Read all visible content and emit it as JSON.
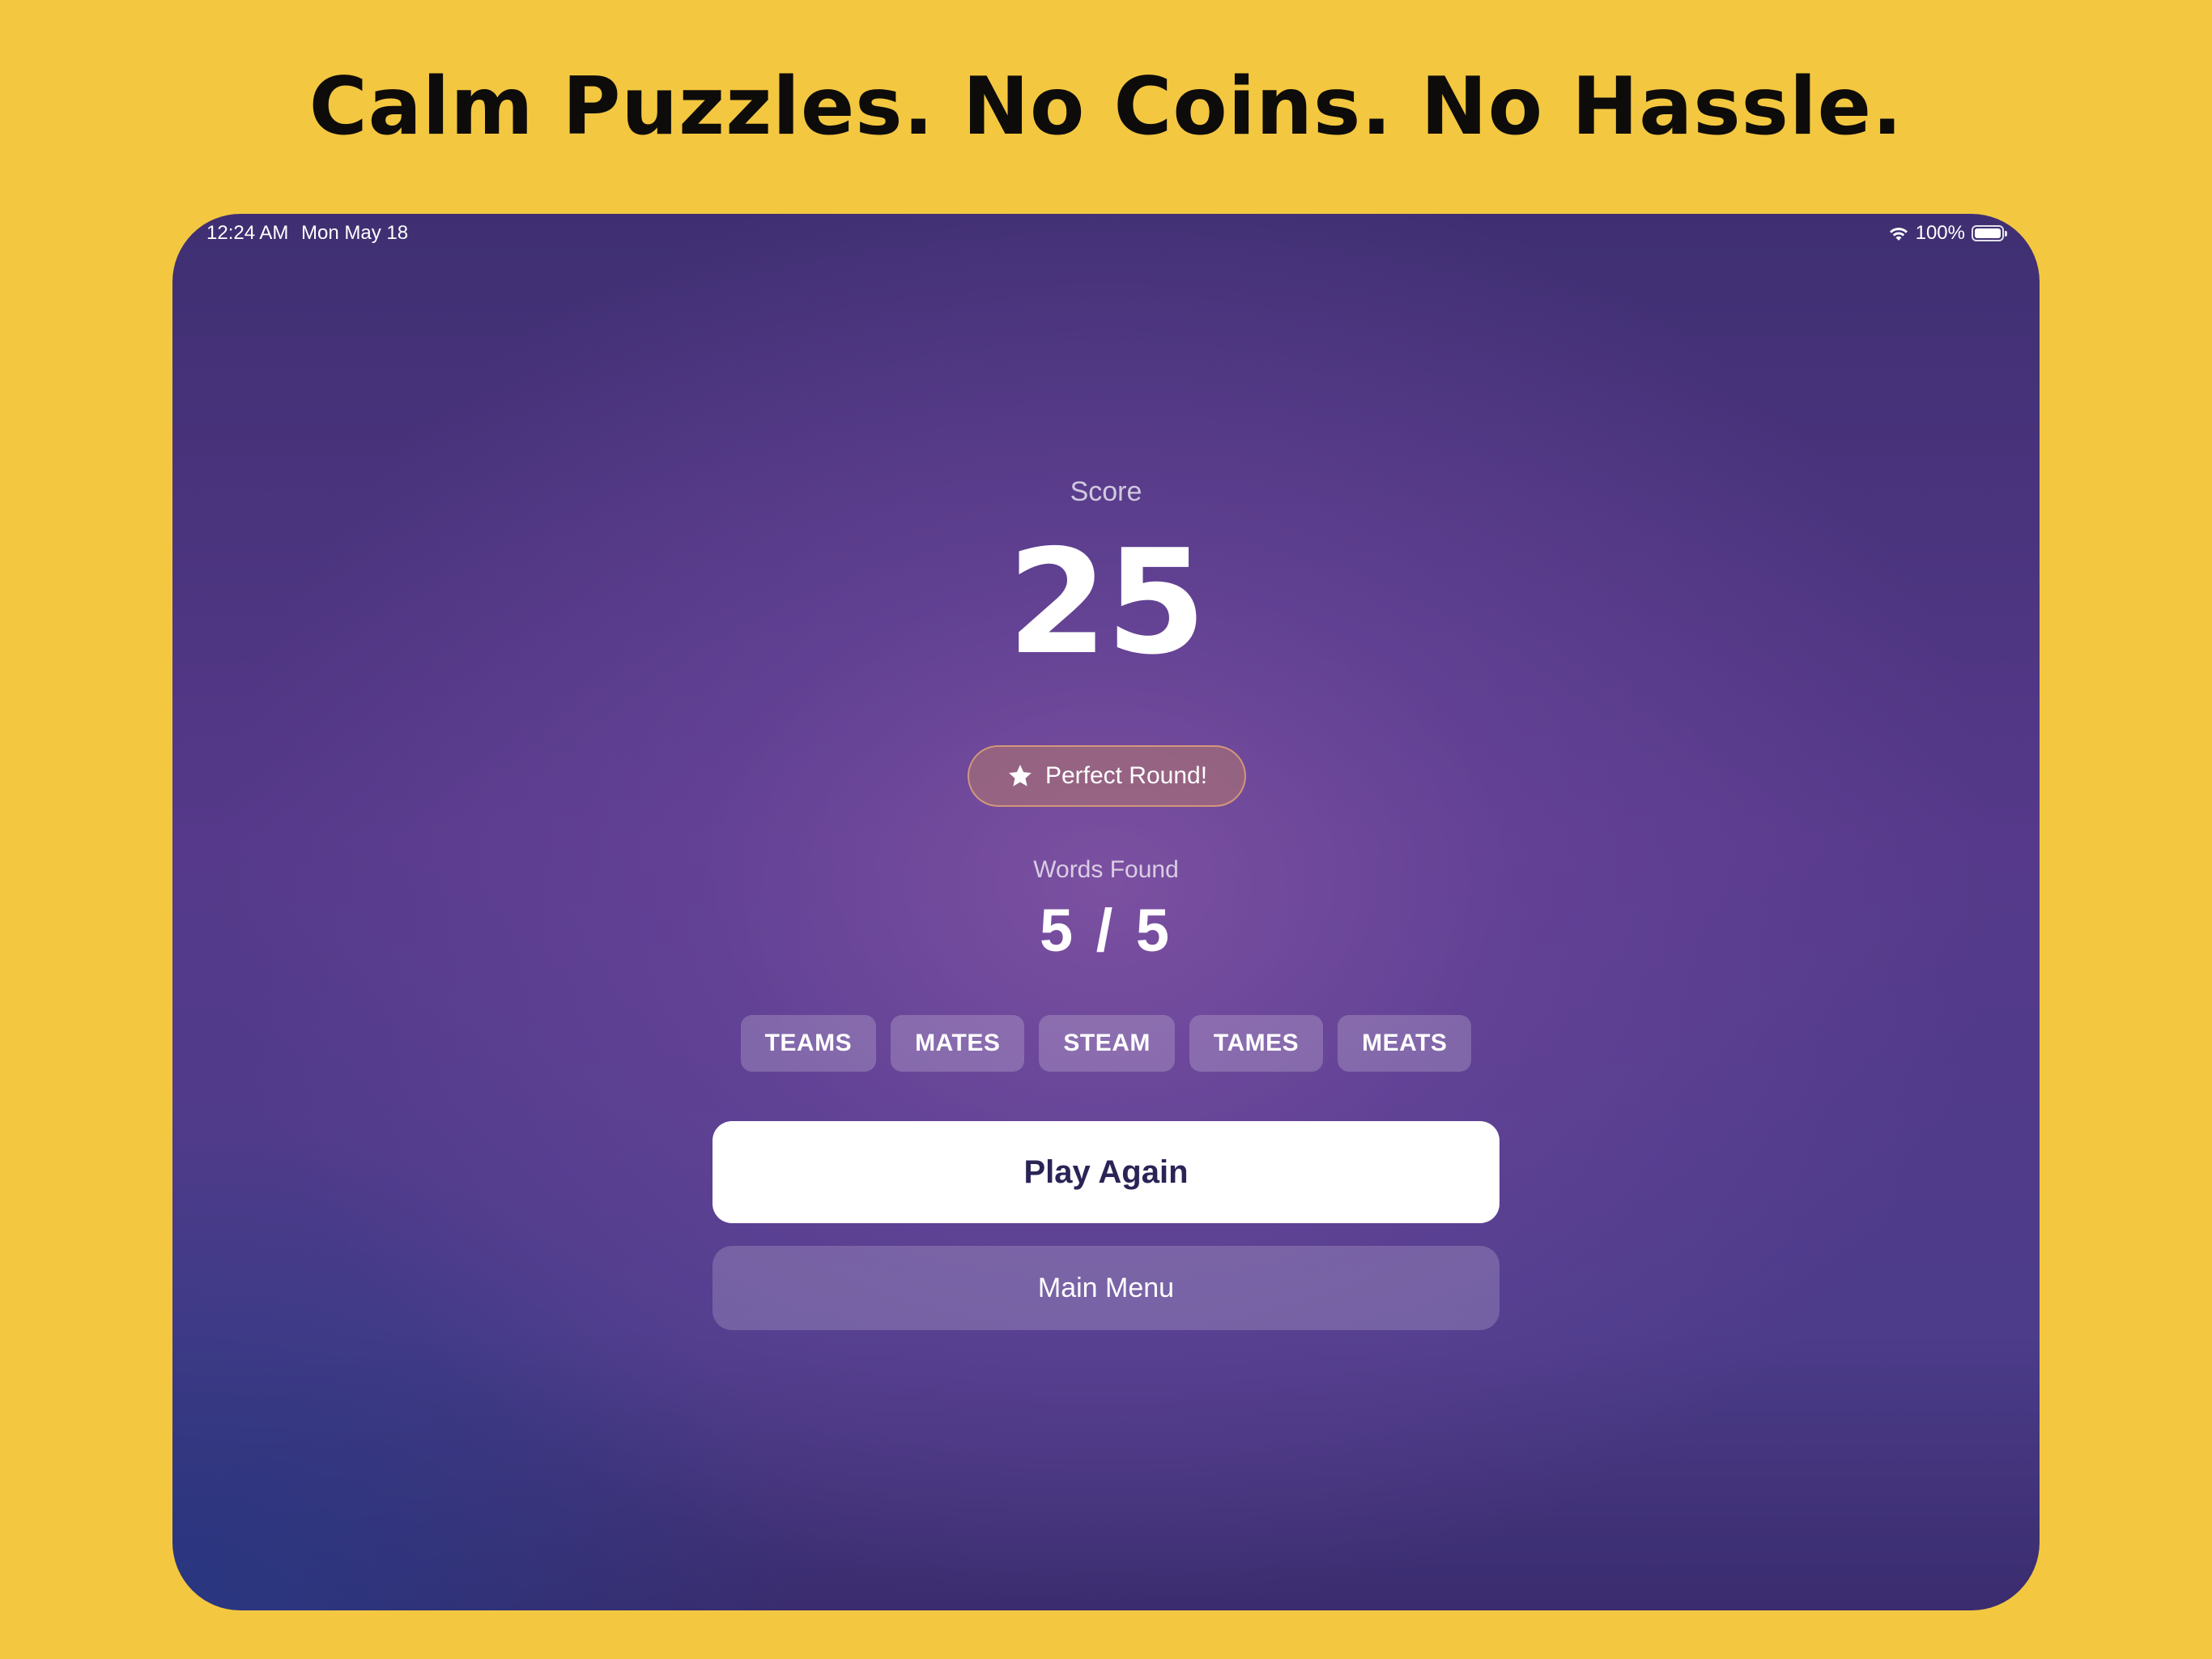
{
  "headline": "Calm Puzzles. No Coins. No Hassle.",
  "status_bar": {
    "time": "12:24 AM",
    "date": "Mon May 18",
    "battery": "100%",
    "battery_level": 1.0
  },
  "results": {
    "score_label": "Score",
    "score_value": "25",
    "badge": {
      "icon": "star-icon",
      "label": "Perfect Round!"
    },
    "words_found_label": "Words Found",
    "words_found_value": "5 / 5",
    "words": [
      "TEAMS",
      "MATES",
      "STEAM",
      "TAMES",
      "MEATS"
    ]
  },
  "buttons": {
    "play_again": "Play Again",
    "main_menu": "Main Menu"
  },
  "colors": {
    "page_background": "#F3C740",
    "primary_button_text": "#2A2456"
  }
}
